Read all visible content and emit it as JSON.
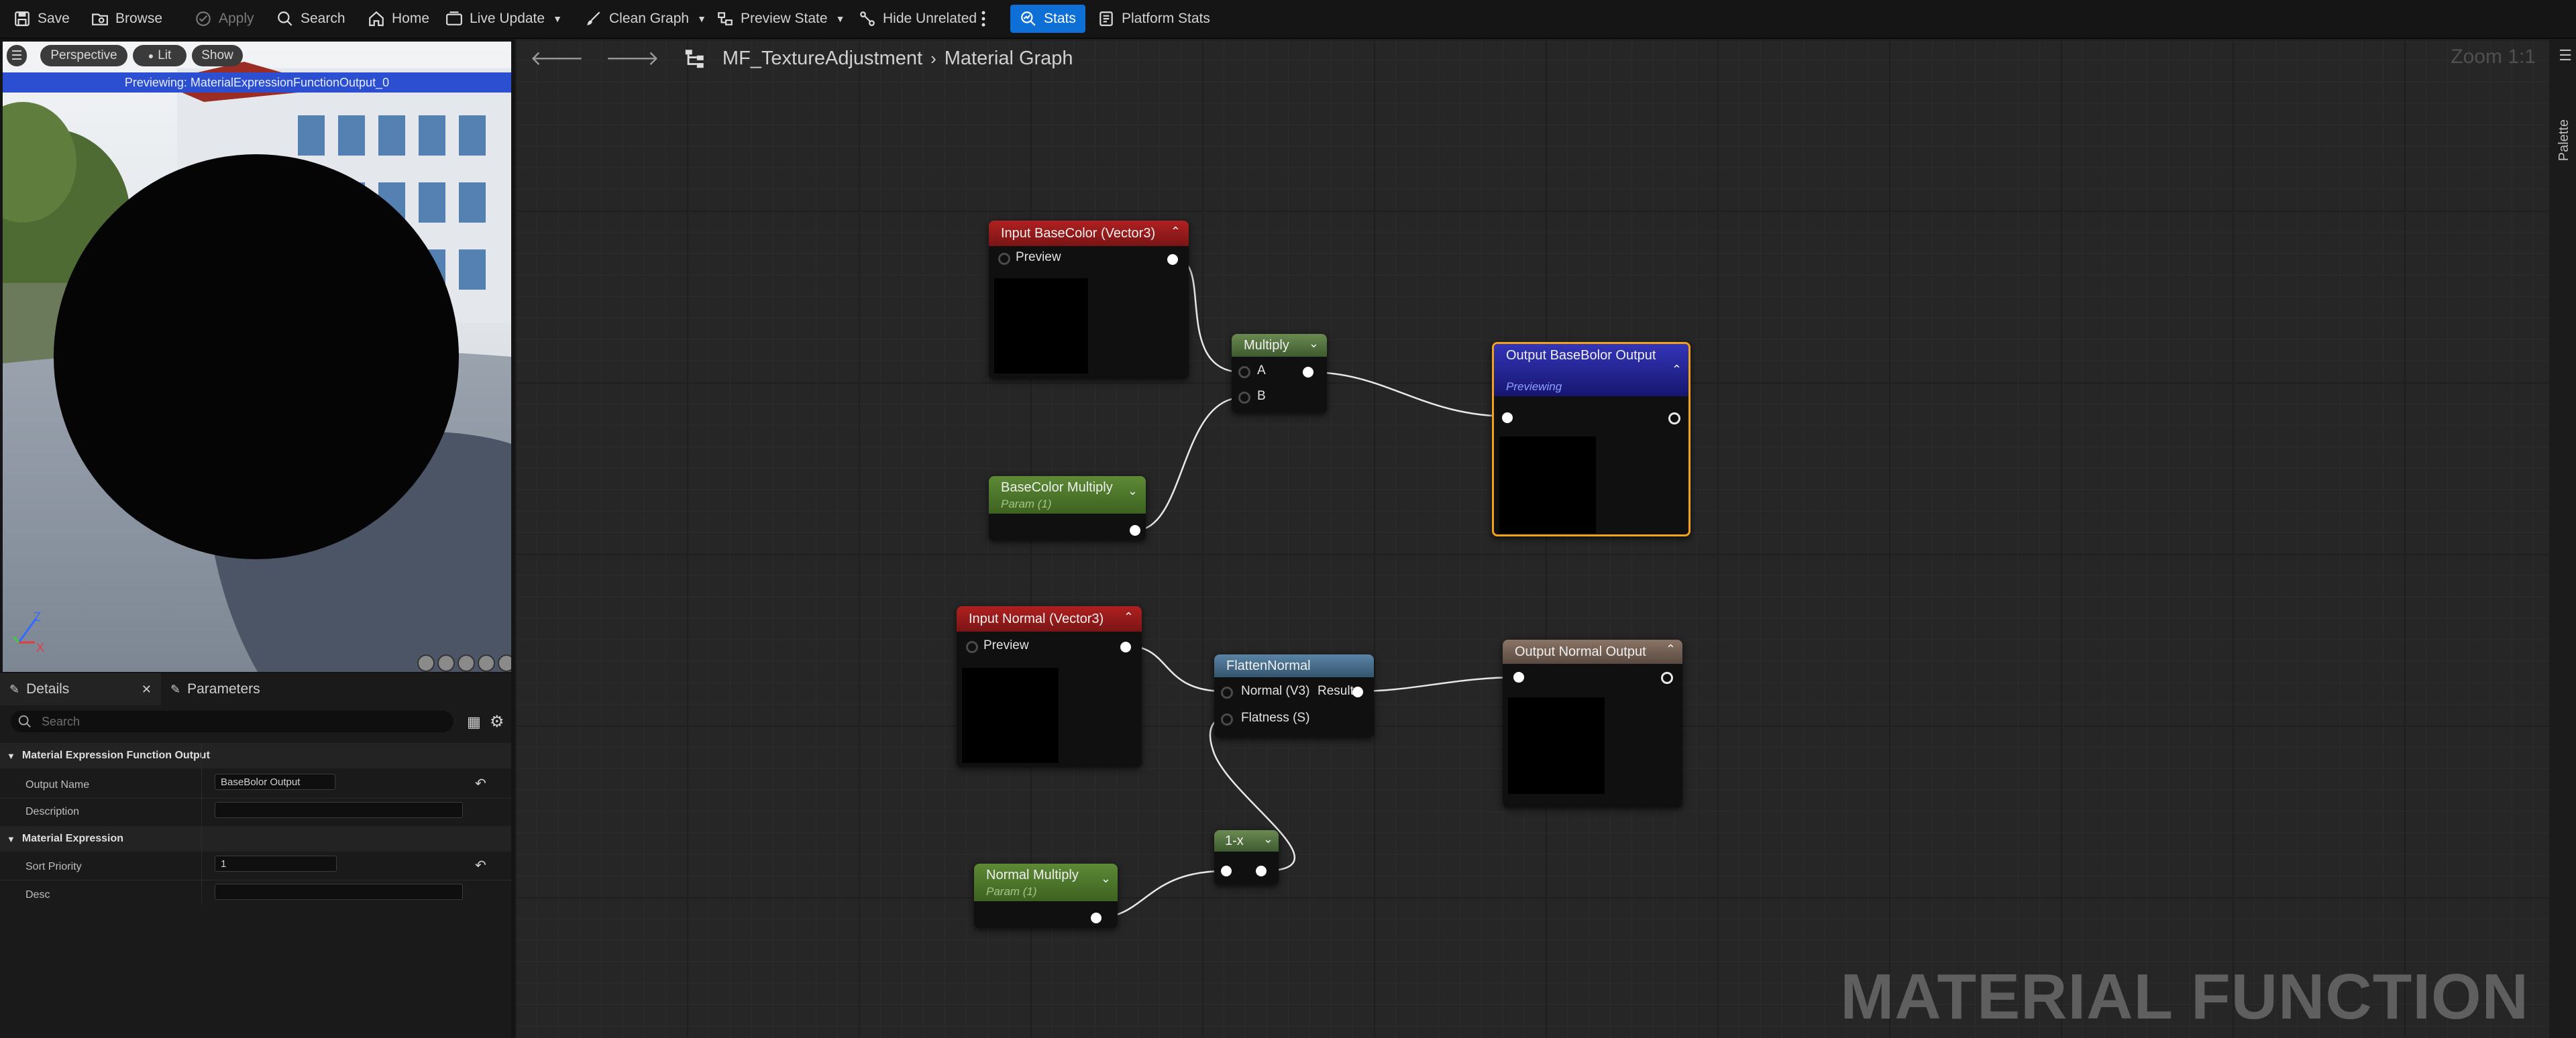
{
  "toolbar": {
    "save": "Save",
    "browse": "Browse",
    "apply": "Apply",
    "search": "Search",
    "home": "Home",
    "live_update": "Live Update",
    "clean_graph": "Clean Graph",
    "preview_state": "Preview State",
    "hide_unrelated": "Hide Unrelated",
    "stats": "Stats",
    "platform_stats": "Platform Stats"
  },
  "viewport": {
    "perspective": "Perspective",
    "lit": "Lit",
    "show": "Show",
    "banner": "Previewing: MaterialExpressionFunctionOutput_0",
    "axis_z": "Z",
    "axis_x": "X"
  },
  "details": {
    "tab_details": "Details",
    "tab_parameters": "Parameters",
    "search_placeholder": "Search",
    "category_output": "Material Expression Function Output",
    "output_name_label": "Output Name",
    "output_name_value": "BaseBolor Output",
    "description_label": "Description",
    "description_value": "",
    "category_expression": "Material Expression",
    "sort_priority_label": "Sort Priority",
    "sort_priority_value": "1",
    "desc_label": "Desc",
    "desc_value": ""
  },
  "graph": {
    "breadcrumb_asset": "MF_TextureAdjustment",
    "breadcrumb_graph": "Material Graph",
    "zoom": "Zoom 1:1",
    "watermark": "MATERIAL FUNCTION",
    "palette": "Palette",
    "nodes": {
      "input_basecolor": {
        "title": "Input BaseColor (Vector3)",
        "pin": "Preview",
        "color": "#8c1c1c"
      },
      "multiply": {
        "title": "Multiply",
        "pin_a": "A",
        "pin_b": "B",
        "color": "#4c6a3a"
      },
      "basecolor_multiply": {
        "title": "BaseColor Multiply",
        "subtitle": "Param (1)",
        "color": "#4f7a2e"
      },
      "output_basecolor": {
        "title": "Output BaseBolor Output",
        "subtitle": "Previewing",
        "color": "#1f1f8a",
        "highlight": "#f0a21c"
      },
      "input_normal": {
        "title": "Input Normal (Vector3)",
        "pin": "Preview",
        "color": "#8c1c1c"
      },
      "flatten_normal": {
        "title": "FlattenNormal",
        "pin_normal": "Normal (V3)",
        "pin_result": "Result",
        "pin_flatness": "Flatness (S)",
        "color": "#4a6d88"
      },
      "output_normal": {
        "title": "Output Normal Output",
        "color": "#6a5a50"
      },
      "normal_multiply": {
        "title": "Normal Multiply",
        "subtitle": "Param (1)",
        "color": "#4f7a2e"
      },
      "one_minus": {
        "title": "1-x",
        "color": "#4c6a3a"
      }
    }
  }
}
